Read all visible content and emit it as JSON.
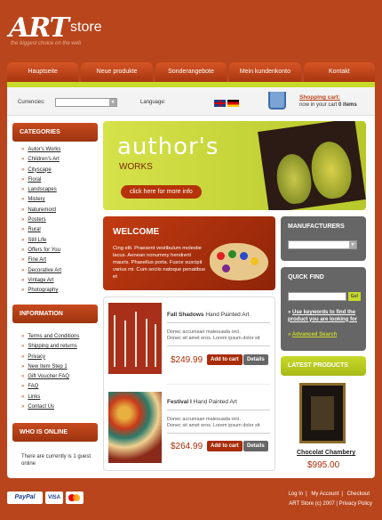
{
  "brand": {
    "logo_main": "ART",
    "logo_sub": "store",
    "tagline": "the biggest choice on the web"
  },
  "nav": [
    "Hauptseite",
    "Neue produkte",
    "Sonderangebote",
    "Mein kundenkonto",
    "Kontakt"
  ],
  "toolbar": {
    "currencies_label": "Currencies:",
    "language_label": "Language:",
    "cart_title": "Shopping cart:",
    "cart_text": "now in your cart",
    "cart_count": "0",
    "cart_items": "items"
  },
  "categories": {
    "title": "CATEGORIES",
    "items": [
      "Autor's Works",
      "Children's Art",
      "Cityscape",
      "Floral",
      "Landscapes",
      "Mistery",
      "Naturemord",
      "Posters",
      "Rural",
      "Still Life",
      "Offers for You",
      "Fine Art",
      "Decorative Art",
      "Vintage Art",
      "Photography"
    ]
  },
  "information": {
    "title": "INFORMATION",
    "items": [
      "Terms and Conditions",
      "Shipping and returns",
      "Privacy",
      "New Item Step 1",
      "Gift Voucher FAQ",
      "FAQ",
      "Links",
      "Contact Us"
    ]
  },
  "whos_online": {
    "title": "WHO IS ONLINE",
    "text": "There are currently is 1 guest online"
  },
  "banner": {
    "title": "author's",
    "subtitle": "WORKS",
    "button": "click here for more info"
  },
  "welcome": {
    "title": "WELCOME",
    "text": "Cing elit. Praesent vestibulum molestie lacus. Aenean nonummy hendrerit mauris. Phasellus porta. Fusce suscipit varius mi. Cum sociis natoque penatibus et"
  },
  "manufacturers": {
    "title": "MANUFACTURERS"
  },
  "quick_find": {
    "title": "QUICK FIND",
    "go": "Go!",
    "hint": "Use keywords to find the product you are looking for",
    "advanced": "Advanced Search"
  },
  "latest": {
    "title": "LATEST PRODUCTS",
    "name": "Chocolat Chambery",
    "price": "$995.00"
  },
  "products": [
    {
      "name": "Fall Shadows",
      "type": "Hand Painted Art",
      "desc1": "Donec accumsan malesuada orci.",
      "desc2": "Donec sit amet eros. Lorem ipsum dolor sit",
      "price": "$249.99",
      "add": "Add to cart",
      "details": "Details"
    },
    {
      "name": "Festival I",
      "type": "Hand Painted Art",
      "desc1": "Donec accumsan malesuada orci.",
      "desc2": "Donec sit amet eros. Lorem ipsum dolor sit",
      "price": "$264.99",
      "add": "Add to cart",
      "details": "Details"
    }
  ],
  "footer": {
    "links": [
      "Log In",
      "My Account",
      "Checkout"
    ],
    "copyright": "ART Store (c) 2007 | Privacy Policy",
    "payments": [
      "PayPal",
      "VISA",
      "MasterCard"
    ]
  },
  "colors": {
    "brand": "#b8451c",
    "accent": "#c7d92a",
    "price": "#a82c06"
  }
}
